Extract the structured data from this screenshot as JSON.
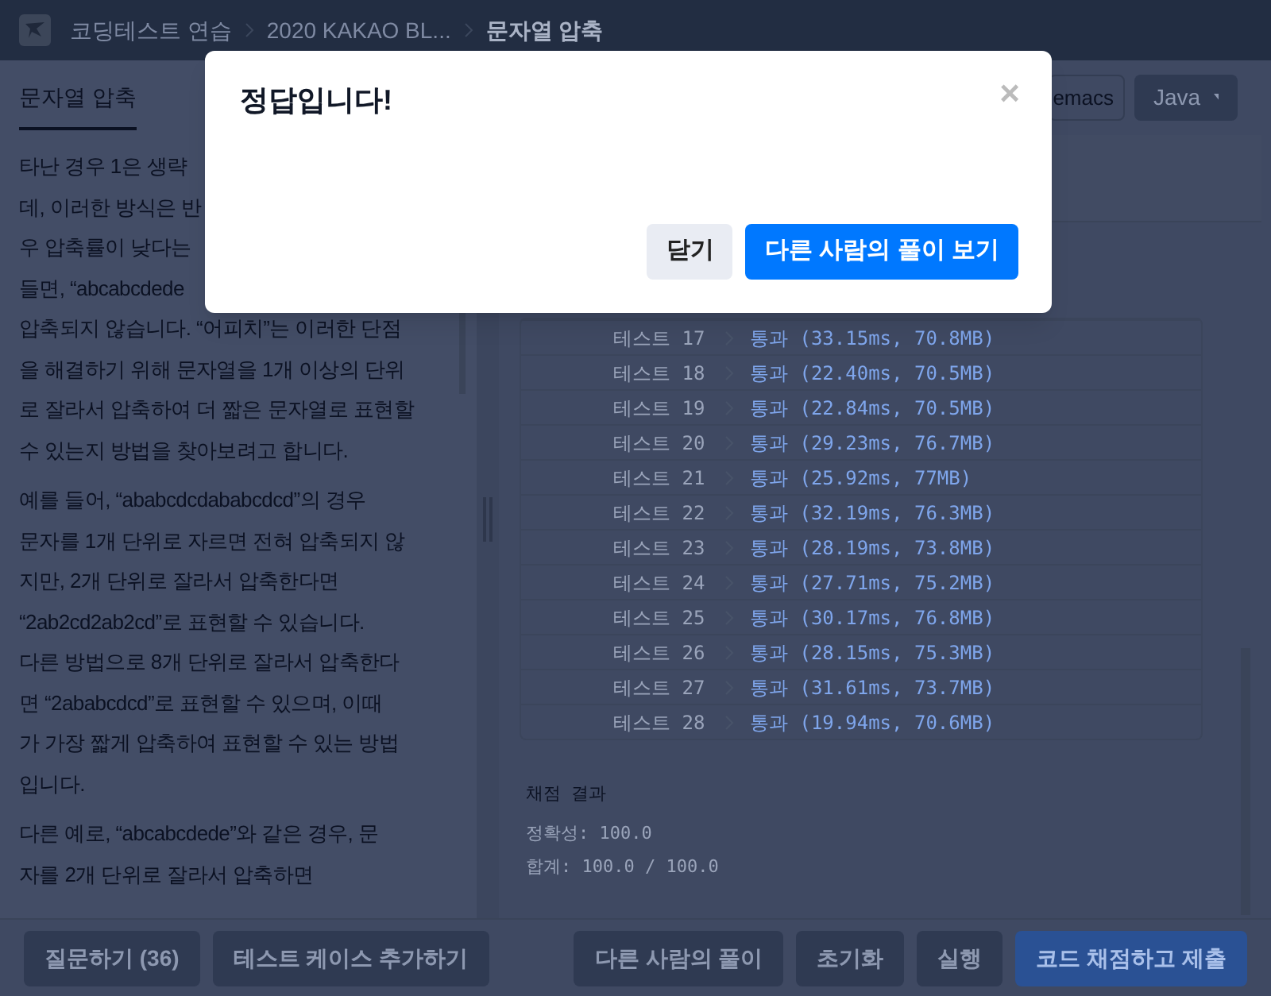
{
  "header": {
    "breadcrumbs": [
      {
        "label": "코딩테스트 연습",
        "current": false
      },
      {
        "label": "2020 KAKAO BL...",
        "current": false
      },
      {
        "label": "문자열 압축",
        "current": true
      }
    ]
  },
  "problem": {
    "tab": "문자열 압축",
    "paragraphs": [
      [
        "타난 경우 1은 생략",
        "데, 이러한 방식은 반",
        "우 압축률이 낮다는",
        "들면, “abcabcdede",
        "압축되지 않습니다. “어피치”는 이러한 단점",
        "을 해결하기 위해 문자열을 1개 이상의 단위",
        "로 잘라서 압축하여 더 짧은 문자열로 표현할",
        "수 있는지 방법을 찾아보려고 합니다."
      ],
      [
        "예를 들어, “ababcdcdababcdcd”의 경우",
        "문자를 1개 단위로 자르면 전혀 압축되지 않",
        "지만, 2개 단위로 잘라서 압축한다면",
        "“2ab2cd2ab2cd”로 표현할 수 있습니다.",
        "다른 방법으로 8개 단위로 잘라서 압축한다",
        "면 “2ababcdcd”로 표현할 수 있으며, 이때",
        "가 가장 짧게 압축하여 표현할 수 있는 방법",
        "입니다."
      ],
      [
        "다른 예로, “abcabcdede”와 같은 경우, 문",
        "자를 2개 단위로 잘라서 압축하면"
      ]
    ]
  },
  "editor": {
    "keymap": "emacs",
    "language": "Java"
  },
  "results": [
    {
      "test": "테스트 17",
      "result": "통과 (33.15ms, 70.8MB)",
      "passed": true
    },
    {
      "test": "테스트 18",
      "result": "통과 (22.40ms, 70.5MB)",
      "passed": true
    },
    {
      "test": "테스트 19",
      "result": "통과 (22.84ms, 70.5MB)",
      "passed": true
    },
    {
      "test": "테스트 20",
      "result": "통과 (29.23ms, 76.7MB)",
      "passed": true
    },
    {
      "test": "테스트 21",
      "result": "통과 (25.92ms, 77MB)",
      "passed": true
    },
    {
      "test": "테스트 22",
      "result": "통과 (32.19ms, 76.3MB)",
      "passed": true
    },
    {
      "test": "테스트 23",
      "result": "통과 (28.19ms, 73.8MB)",
      "passed": true
    },
    {
      "test": "테스트 24",
      "result": "통과 (27.71ms, 75.2MB)",
      "passed": true
    },
    {
      "test": "테스트 25",
      "result": "통과 (30.17ms, 76.8MB)",
      "passed": true
    },
    {
      "test": "테스트 26",
      "result": "통과 (28.15ms, 75.3MB)",
      "passed": true
    },
    {
      "test": "테스트 27",
      "result": "통과 (31.61ms, 73.7MB)",
      "passed": true
    },
    {
      "test": "테스트 28",
      "result": "통과 (19.94ms, 70.6MB)",
      "passed": true
    }
  ],
  "summary": {
    "title": "채점 결과",
    "lines": [
      "정확성: 100.0",
      "합계: 100.0 / 100.0"
    ]
  },
  "footer": {
    "left_buttons": [
      "질문하기 (36)",
      "테스트 케이스 추가하기"
    ],
    "right_buttons": [
      {
        "label": "다른 사람의 풀이",
        "kind": "secondary"
      },
      {
        "label": "초기화",
        "kind": "secondary"
      },
      {
        "label": "실행",
        "kind": "secondary"
      },
      {
        "label": "코드 채점하고 제출",
        "kind": "primary"
      }
    ]
  },
  "modal": {
    "title": "정답입니다!",
    "close": "×",
    "buttons": [
      {
        "label": "닫기",
        "kind": "secondary"
      },
      {
        "label": "다른 사람의 풀이 보기",
        "kind": "primary"
      }
    ]
  }
}
